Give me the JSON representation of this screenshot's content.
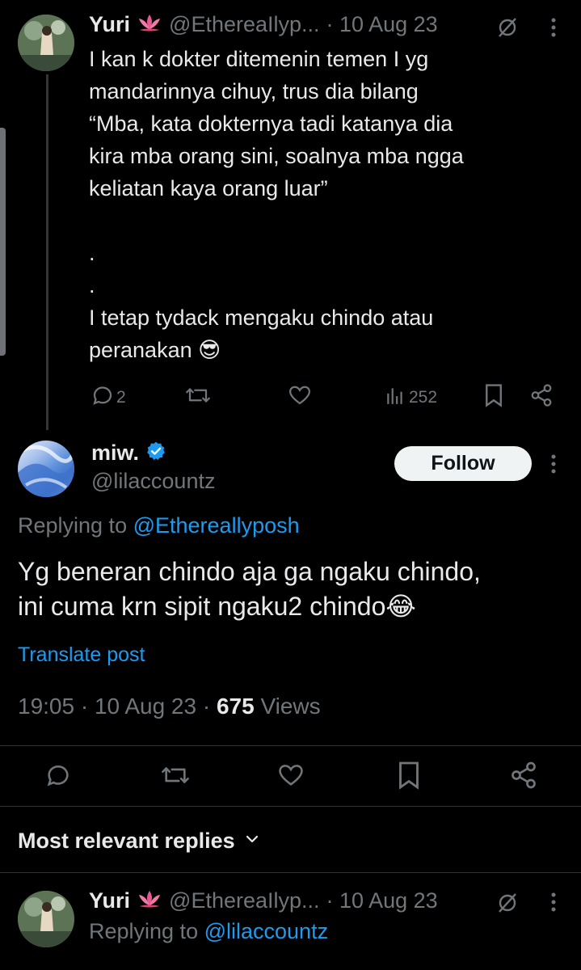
{
  "tweet_top": {
    "name": "Yuri",
    "handle": "@EthereaIlyp...",
    "date": "· 10 Aug 23",
    "text": "I kan k dokter ditemenin temen I yg\nmandarinnya cihuy, trus dia bilang\n“Mba, kata dokternya tadi katanya dia\nkira mba orang sini, soalnya mba ngga\nkeliatan kaya orang luar”\n\n.\n.\nI tetap tydack mengaku chindo atau\nperanakan 😎",
    "replies": "2",
    "views": "252"
  },
  "main_tweet": {
    "name": "miw.",
    "handle": "@lilaccountz",
    "follow_label": "Follow",
    "replying_prefix": "Replying to ",
    "replying_to": "@Ethereallyposh",
    "text": "Yg beneran chindo aja ga ngaku chindo,\nini cuma krn sipit ngaku2 chindo😂",
    "translate": "Translate post",
    "time": "19:05 · 10 Aug 23 · ",
    "views_count": "675",
    "views_label": " Views"
  },
  "replies_header": "Most relevant replies",
  "tweet_bottom": {
    "name": "Yuri",
    "handle": "@EthereaIlyp...",
    "date": "· 10 Aug 23",
    "replying_prefix": "Replying to ",
    "replying_to": "@lilaccountz"
  },
  "colors": {
    "background": "#000000",
    "text": "#e7e9ea",
    "muted": "#71767b",
    "link": "#1d9bf0",
    "verified": "#1d9bf0",
    "lotus": "#e8578f"
  }
}
